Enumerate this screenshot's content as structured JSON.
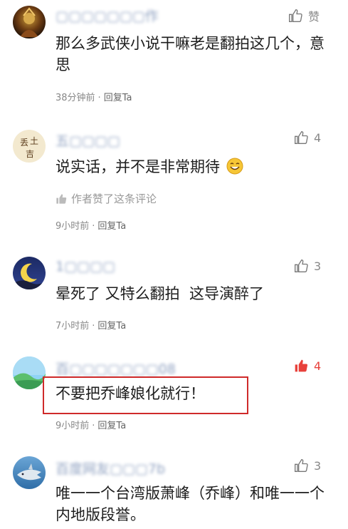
{
  "comments": [
    {
      "username": "▢▢▢▢▢▢▢作",
      "like_label": "赞",
      "like_count": "",
      "liked": false,
      "text": "那么多武侠小说干嘛老是翻拍这几个，意思",
      "time": "38分钟前",
      "reply": "回复Ta"
    },
    {
      "username": "五▢▢▢▢",
      "like_label": "",
      "like_count": "4",
      "liked": false,
      "text": "说实话，并不是非常期待",
      "emoji": "smile-emoji",
      "author_liked": "作者赞了这条评论",
      "time": "9小时前",
      "reply": "回复Ta"
    },
    {
      "username": "1▢▢▢▢",
      "like_label": "",
      "like_count": "3",
      "liked": false,
      "text": "晕死了 又特么翻拍  这导演醉了",
      "time": "7小时前",
      "reply": "回复Ta"
    },
    {
      "username": "百▢▢▢▢▢▢▢08",
      "like_label": "",
      "like_count": "4",
      "liked": true,
      "text": "不要把乔峰娘化就行！",
      "time": "9小时前",
      "reply": "回复Ta"
    },
    {
      "username": "百度网友▢▢▢7b",
      "like_label": "",
      "like_count": "3",
      "liked": false,
      "text": "唯一一个台湾版萧峰（乔峰）和唯一一个内地版段誉。",
      "time": "",
      "reply": ""
    }
  ],
  "colors": {
    "liked": "#e8413b",
    "highlight_border": "#cf2a2a",
    "username": "#7a8fb5"
  }
}
